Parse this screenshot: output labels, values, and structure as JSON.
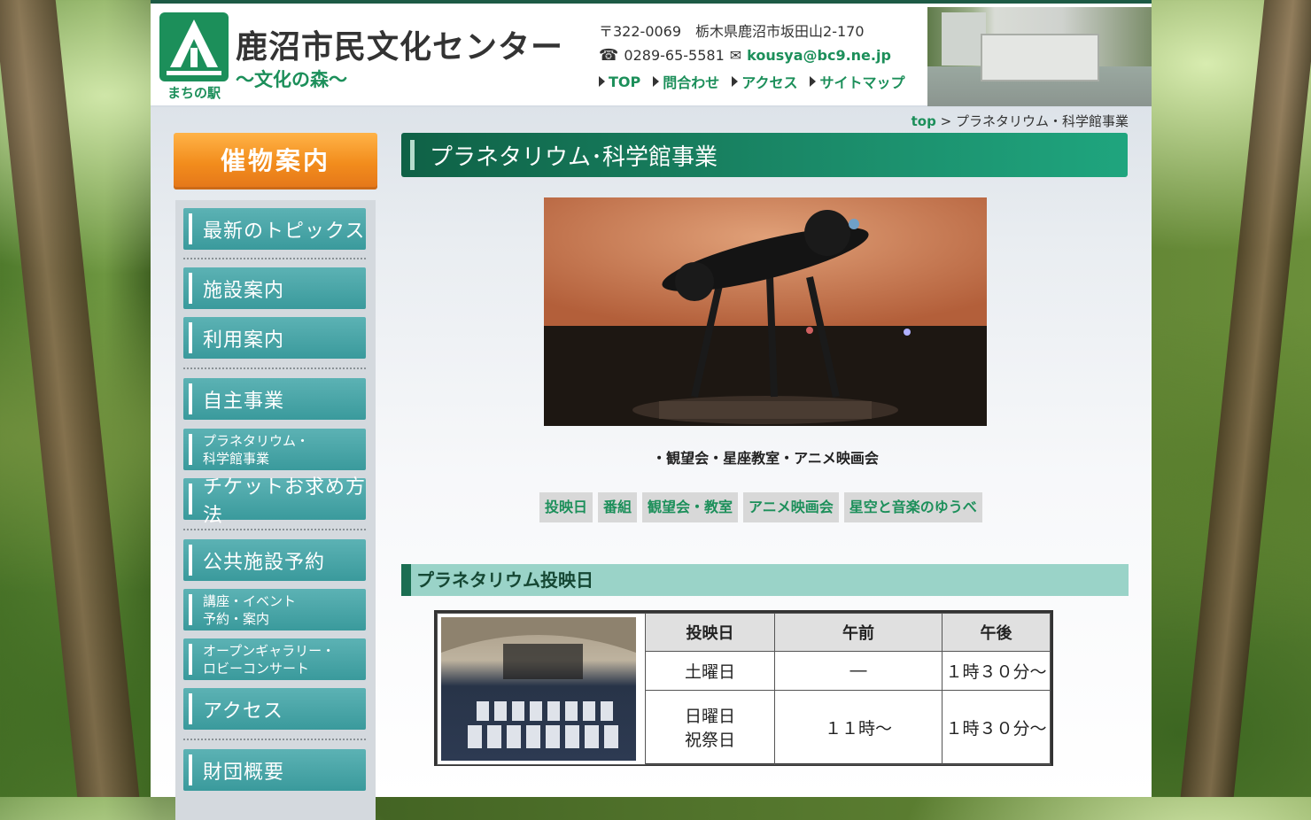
{
  "header": {
    "logo_text": "まちの駅",
    "title": "鹿沼市民文化センター",
    "tagline": "～文化の森～",
    "address": "〒322-0069　栃木県鹿沼市坂田山2-170",
    "phone": "0289-65-5581",
    "email": "kousya@bc9.ne.jp",
    "nav": [
      {
        "label": "TOP"
      },
      {
        "label": "問合わせ"
      },
      {
        "label": "アクセス"
      },
      {
        "label": "サイトマップ"
      }
    ]
  },
  "breadcrumb": {
    "home": "top",
    "separator": ">",
    "current": "プラネタリウム・科学館事業"
  },
  "sidebar": {
    "heading": "催物案内",
    "items": [
      {
        "label": "最新のトピックス"
      },
      {
        "label": "施設案内"
      },
      {
        "label": "利用案内"
      },
      {
        "label": "自主事業"
      },
      {
        "label": "プラネタリウム・\n科学館事業"
      },
      {
        "label": "チケットお求め方法"
      },
      {
        "label": "公共施設予約"
      },
      {
        "label": "講座・イベント\n予約・案内"
      },
      {
        "label": "オープンギャラリー・\nロビーコンサート"
      },
      {
        "label": "アクセス"
      },
      {
        "label": "財団概要"
      }
    ]
  },
  "main": {
    "title": "プラネタリウム･科学館事業",
    "caption": "・観望会・星座教室・アニメ映画会",
    "subnav": [
      {
        "label": "投映日"
      },
      {
        "label": "番組"
      },
      {
        "label": "観望会・教室"
      },
      {
        "label": "アニメ映画会"
      },
      {
        "label": "星空と音楽のゆうべ"
      }
    ],
    "section_title": "プラネタリウム投映日",
    "schedule": {
      "headers": [
        "投映日",
        "午前",
        "午後"
      ],
      "rows": [
        {
          "day": "土曜日",
          "am": "―",
          "pm": "１時３０分～"
        },
        {
          "day": "日曜日\n祝祭日",
          "am": "１１時～",
          "pm": "１時３０分～"
        }
      ]
    }
  },
  "colors": {
    "brand_green": "#1c8f5a",
    "menu_teal": "#3a9a9c",
    "accent_orange": "#f28c1c"
  }
}
